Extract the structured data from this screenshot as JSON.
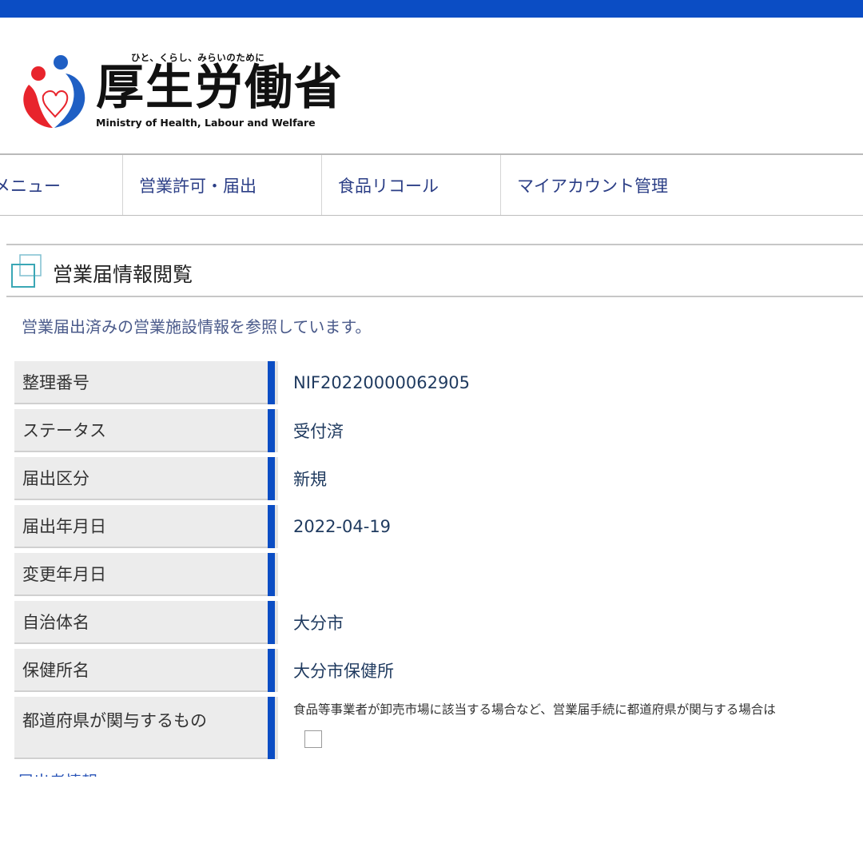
{
  "brand": {
    "tagline": "ひと、くらし、みらいのために",
    "name": "厚生労働省",
    "english_name": "Ministry of Health, Labour and Welfare",
    "colors": {
      "top_bar": "#0b4dc4",
      "logo_red": "#e8242c",
      "logo_blue": "#1f5fc4"
    }
  },
  "nav": {
    "items": [
      {
        "label": "メニュー"
      },
      {
        "label": "営業許可・届出"
      },
      {
        "label": "食品リコール"
      },
      {
        "label": "マイアカウント管理"
      }
    ]
  },
  "page": {
    "title": "営業届情報閲覧",
    "title_icon": "window-stack-icon",
    "description": "営業届出済みの営業施設情報を参照しています。"
  },
  "fields": [
    {
      "label": "整理番号",
      "value": "NIF20220000062905"
    },
    {
      "label": "ステータス",
      "value": "受付済"
    },
    {
      "label": "届出区分",
      "value": "新規"
    },
    {
      "label": "届出年月日",
      "value": "2022-04-19"
    },
    {
      "label": "変更年月日",
      "value": ""
    },
    {
      "label": "自治体名",
      "value": "大分市"
    },
    {
      "label": "保健所名",
      "value": "大分市保健所"
    }
  ],
  "prefecture_field": {
    "label": "都道府県が関与するもの",
    "note": "食品等事業者が卸売市場に該当する場合など、営業届手続に都道府県が関与する場合は",
    "checked": false
  },
  "next_section_label": "届出者情報",
  "colors": {
    "accent_blue": "#0b4dc4",
    "label_bg": "#ececec"
  }
}
